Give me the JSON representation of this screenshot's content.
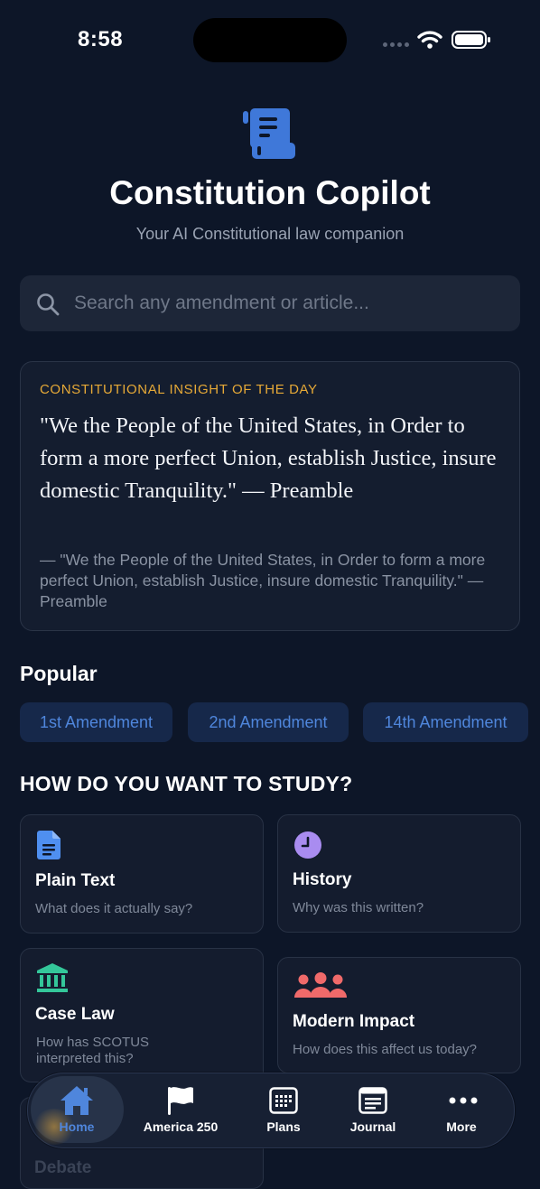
{
  "status": {
    "time": "8:58"
  },
  "header": {
    "title": "Constitution Copilot",
    "subtitle": "Your AI Constitutional law companion"
  },
  "search": {
    "placeholder": "Search any amendment or article..."
  },
  "insight": {
    "label": "CONSTITUTIONAL INSIGHT OF THE DAY",
    "quote": "\"We the People of the United States, in Order to form a more perfect Union, establish Justice, insure domestic Tranquility.\" — Preamble",
    "attribution": "— \"We the People of the United States, in Order to form a more perfect Union, establish Justice, insure domestic Tranquility.\" — Preamble"
  },
  "popular": {
    "title": "Popular",
    "chips": [
      "1st Amendment",
      "2nd Amendment",
      "14th Amendment"
    ]
  },
  "study": {
    "title": "HOW DO YOU WANT TO STUDY?",
    "cards": [
      {
        "title": "Plain Text",
        "desc": "What does it actually say?",
        "icon": "document-icon",
        "color": "#4f8ff0"
      },
      {
        "title": "History",
        "desc": "Why was this written?",
        "icon": "clock-icon",
        "color": "#a98cf0"
      },
      {
        "title": "Case Law",
        "desc": "How has SCOTUS interpreted this?",
        "icon": "courthouse-icon",
        "color": "#34c79a"
      },
      {
        "title": "Modern Impact",
        "desc": "How does this affect us today?",
        "icon": "people-icon",
        "color": "#f06a6a"
      },
      {
        "title": "Debate",
        "desc": "",
        "icon": "",
        "color": ""
      }
    ]
  },
  "tabs": [
    {
      "label": "Home",
      "icon": "home-icon",
      "active": true
    },
    {
      "label": "America 250",
      "icon": "flag-icon",
      "active": false
    },
    {
      "label": "Plans",
      "icon": "calendar-icon",
      "active": false
    },
    {
      "label": "Journal",
      "icon": "journal-icon",
      "active": false
    },
    {
      "label": "More",
      "icon": "more-icon",
      "active": false
    }
  ],
  "colors": {
    "background": "#0d1628",
    "accent": "#4f86dc",
    "gold": "#e6a937"
  }
}
